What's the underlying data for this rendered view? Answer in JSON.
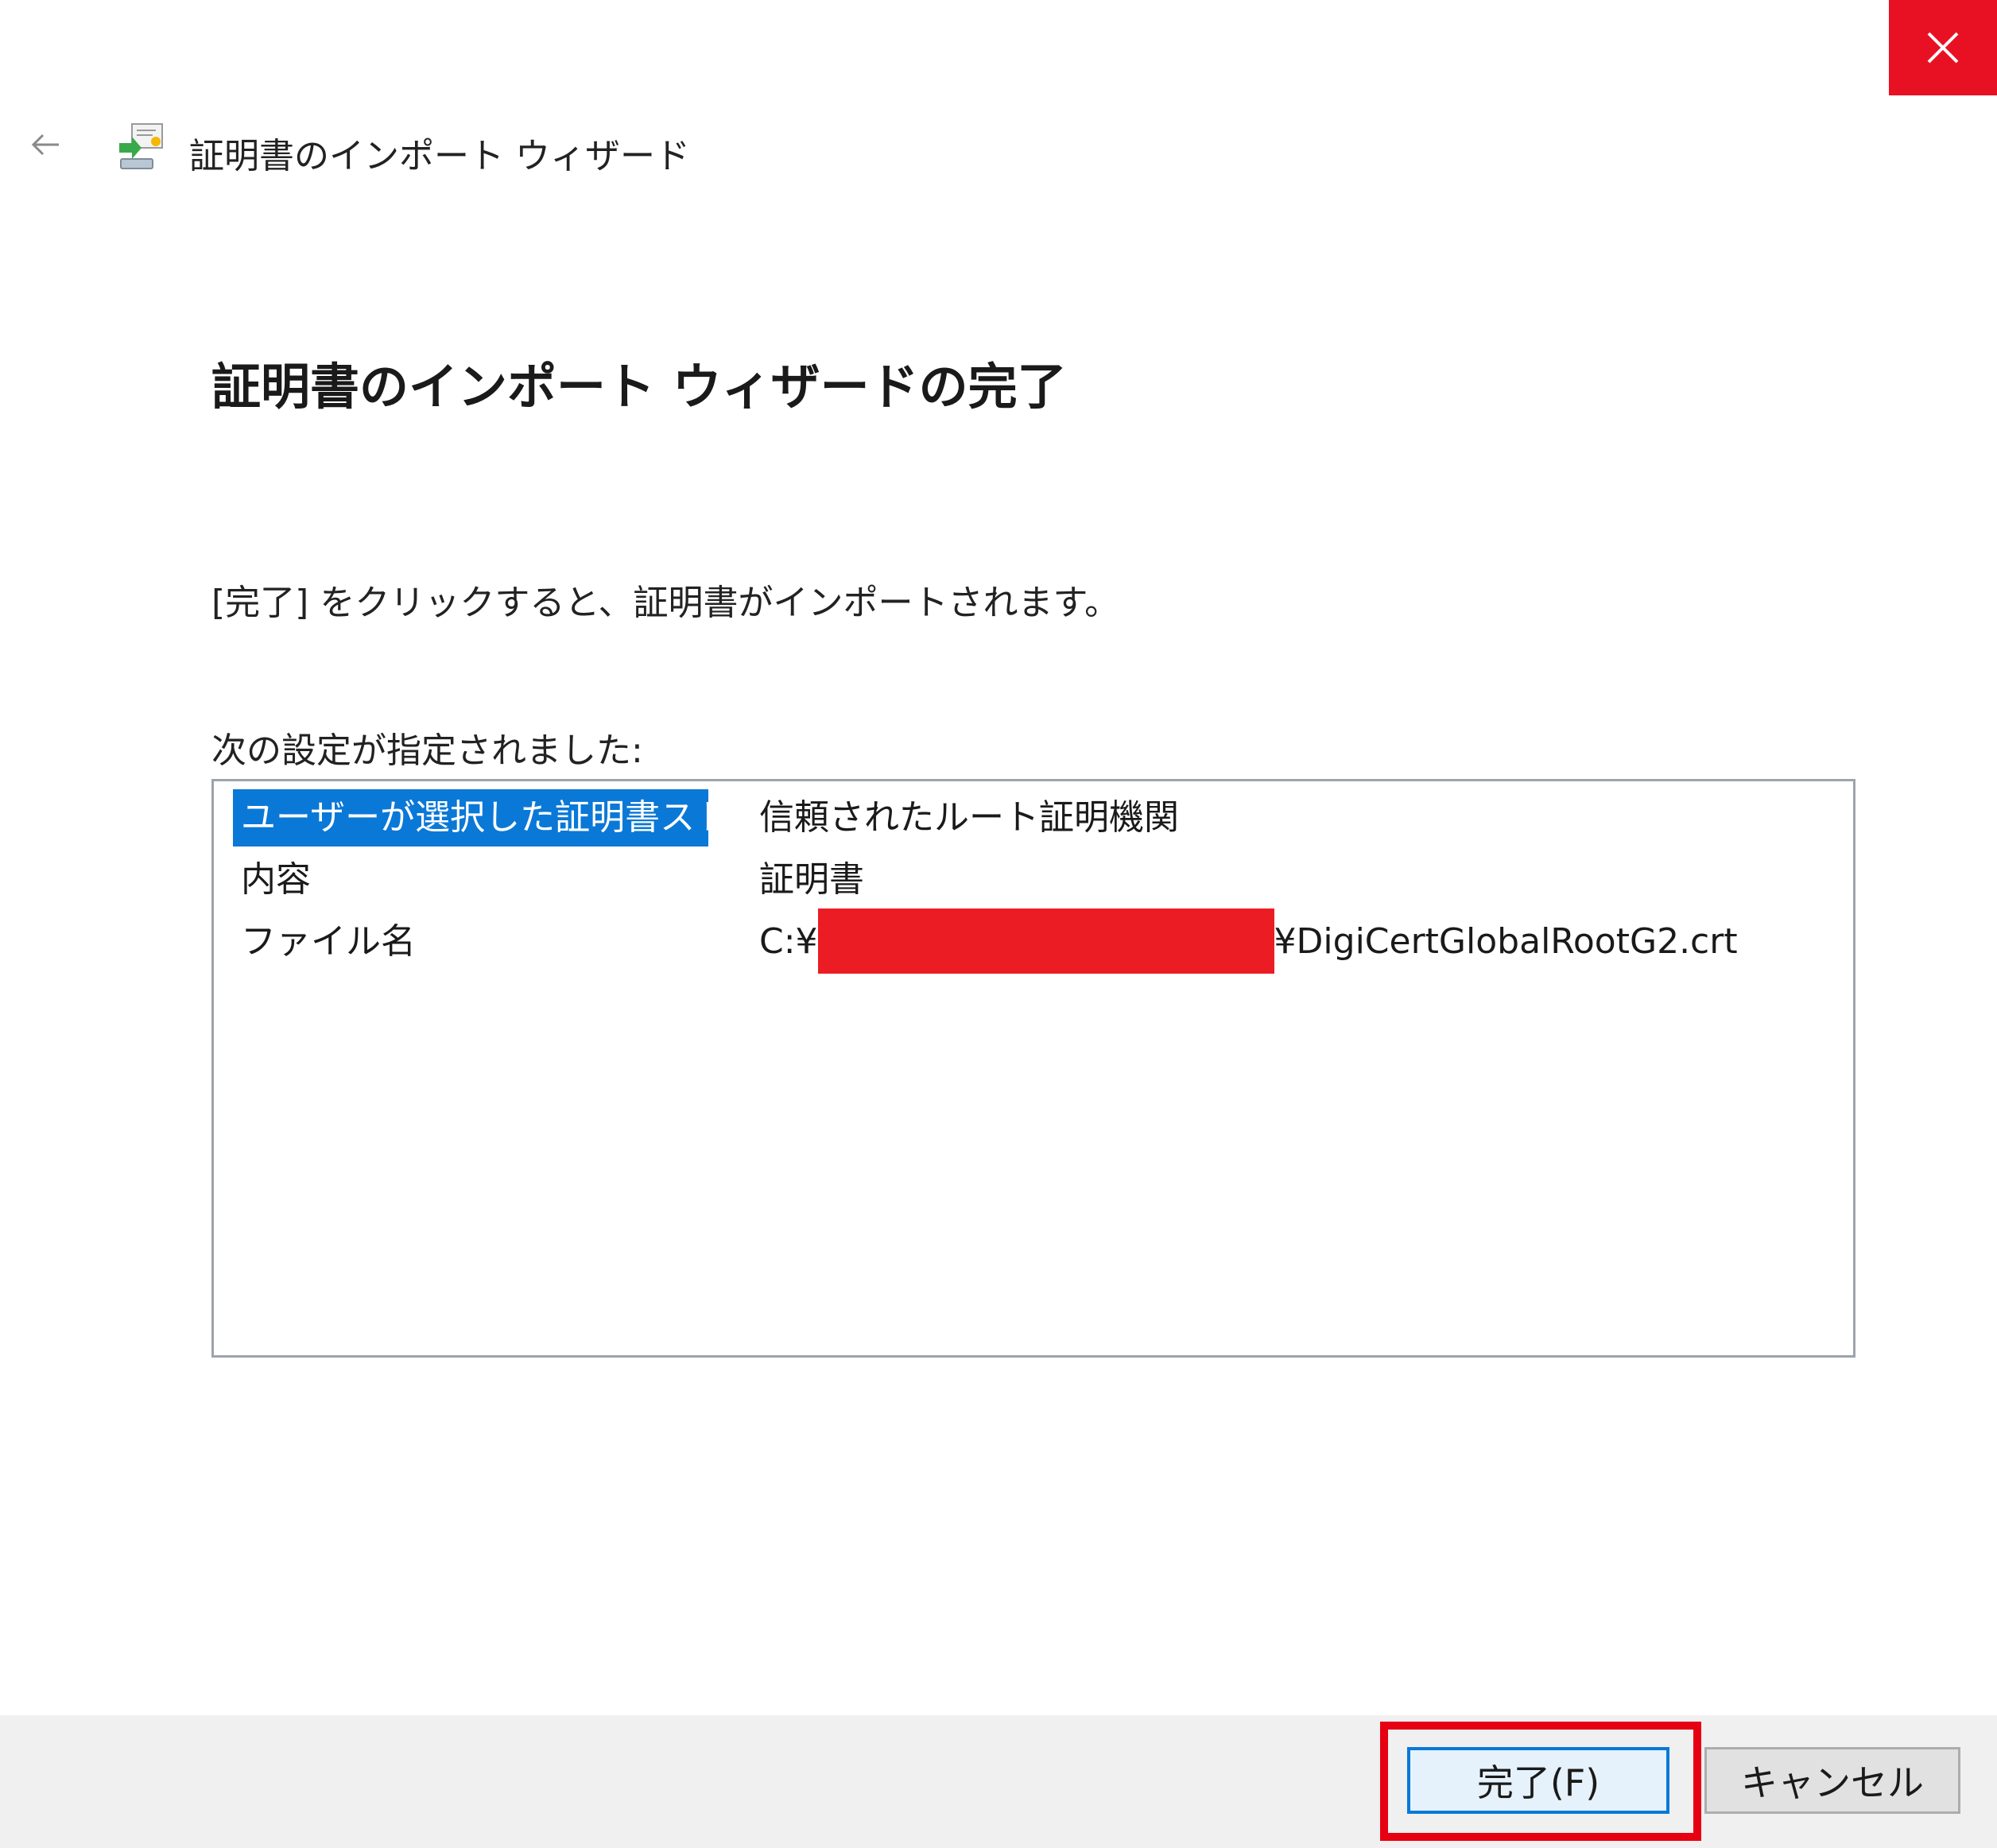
{
  "window": {
    "title": "証明書のインポート ウィザード",
    "close_icon": "close-icon",
    "back_icon": "back-arrow-icon",
    "wizard_icon": "certificate-import-icon"
  },
  "main": {
    "heading": "証明書のインポート ウィザードの完了",
    "description": "[完了] をクリックすると、証明書がインポートされます。",
    "settings_label": "次の設定が指定されました:",
    "settings": [
      {
        "key": "ユーザーが選択した証明書ストア",
        "value": "信頼されたルート証明機関"
      },
      {
        "key": "内容",
        "value": "証明書"
      },
      {
        "key": "ファイル名",
        "value_prefix": "C:¥",
        "value_suffix": "¥DigiCertGlobalRootG2.crt"
      }
    ]
  },
  "footer": {
    "finish_label": "完了(F)",
    "cancel_label": "キャンセル"
  },
  "colors": {
    "close_bg": "#e81123",
    "selection": "#0a78d7",
    "redaction": "#ec1c24",
    "highlight_frame": "#e60012"
  }
}
